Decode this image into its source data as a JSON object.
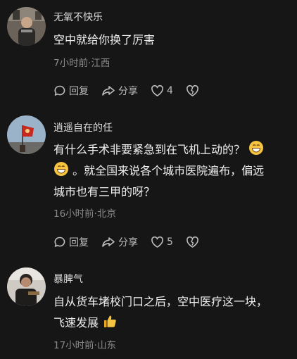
{
  "comments": [
    {
      "username": "无氧不快乐",
      "text_lines": [
        "空中就给你换了厉害"
      ],
      "meta": "7小时前·江西",
      "reply_label": "回复",
      "share_label": "分享",
      "likes": "4"
    },
    {
      "username": "逍遥自在的任",
      "text_line1": "有什么手术非要紧急到在飞机上动的？",
      "text_line2": "。就全国来说各个城市医院遍布，偏远",
      "text_line3": "城市也有三甲的呀？",
      "meta": "16小时前·北京",
      "reply_label": "回复",
      "share_label": "分享",
      "likes": "5"
    },
    {
      "username": "暴脾气",
      "text_line1": "自从货车堵校门口之后，空中医疗这一块，",
      "text_line2": "飞速发展",
      "meta": "17小时前·山东"
    }
  ],
  "icons": {
    "reply": "comment-bubble-icon",
    "share": "share-arrow-icon",
    "like": "heart-icon",
    "dislike": "broken-heart-icon",
    "grin": "grinning-emoji",
    "thumbs": "thumbs-up-emoji"
  },
  "colors": {
    "background": "#161616",
    "text": "#f0f0f0",
    "meta": "#8a8a8a",
    "emoji": "#f5c542"
  }
}
